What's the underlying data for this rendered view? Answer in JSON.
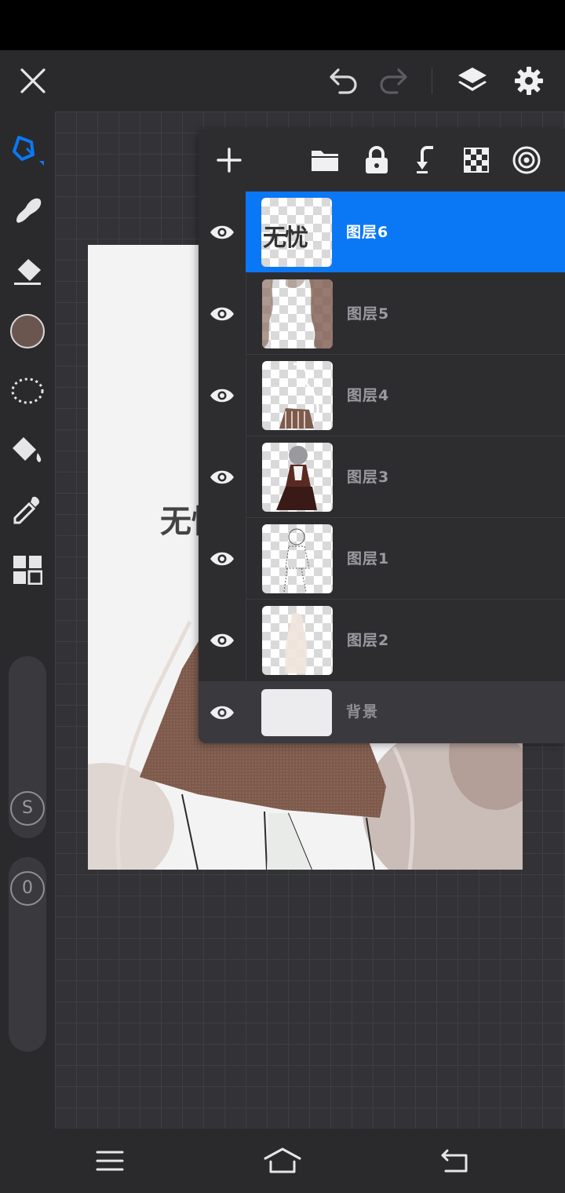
{
  "layers": [
    {
      "name": "图层6",
      "selected": true
    },
    {
      "name": "图层5",
      "selected": false
    },
    {
      "name": "图层4",
      "selected": false
    },
    {
      "name": "图层3",
      "selected": false
    },
    {
      "name": "图层1",
      "selected": false
    },
    {
      "name": "图层2",
      "selected": false
    }
  ],
  "background_layer": {
    "name": "背景"
  },
  "sliders": {
    "size_label": "S",
    "opacity_label": "0"
  },
  "artwork_text": "无忧",
  "thumb_text": "无忧",
  "colors": {
    "accent": "#0a78f5",
    "current_color": "#6b564f",
    "toolbar": "#2a2a2c",
    "panel": "#2d2d30"
  },
  "icons": {
    "topbar": [
      "close-icon",
      "undo-icon",
      "redo-icon",
      "layers-icon",
      "settings-icon"
    ],
    "tools": [
      "brush-icon",
      "smudge-icon",
      "eraser-icon",
      "color-swatch",
      "lasso-icon",
      "fill-bucket-icon",
      "eyedropper-icon",
      "grid-icon"
    ],
    "layers_toolbar": [
      "add-layer-icon",
      "folder-icon",
      "lock-icon",
      "merge-down-icon",
      "alpha-lock-icon",
      "blend-mode-icon"
    ],
    "nav": [
      "menu-icon",
      "home-icon",
      "back-icon"
    ]
  }
}
